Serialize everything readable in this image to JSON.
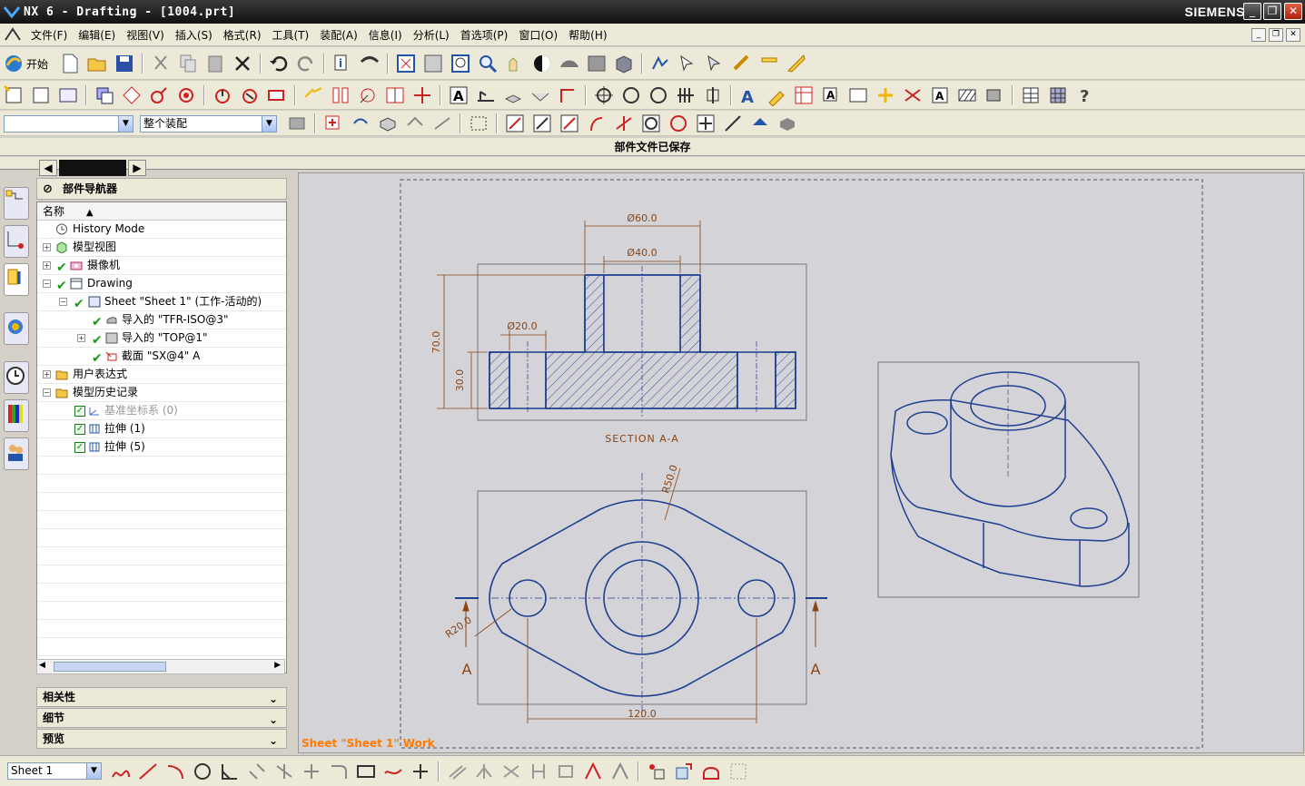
{
  "window": {
    "title": "NX 6 - Drafting - [1004.prt]",
    "brand": "SIEMENS"
  },
  "menu": [
    "文件(F)",
    "编辑(E)",
    "视图(V)",
    "插入(S)",
    "格式(R)",
    "工具(T)",
    "装配(A)",
    "信息(I)",
    "分析(L)",
    "首选项(P)",
    "窗口(O)",
    "帮助(H)"
  ],
  "toolbar": {
    "start_label": "开始"
  },
  "selection": {
    "filter_value": "",
    "assembly_value": "整个装配"
  },
  "status": {
    "message": "部件文件已保存"
  },
  "navigator": {
    "title": "部件导航器",
    "column": "名称",
    "rows": [
      {
        "label": "History Mode"
      },
      {
        "label": "模型视图"
      },
      {
        "label": "摄像机"
      },
      {
        "label": "Drawing"
      },
      {
        "label": "Sheet \"Sheet 1\" (工作-活动的)"
      },
      {
        "label": "导入的 \"TFR-ISO@3\""
      },
      {
        "label": "导入的 \"TOP@1\""
      },
      {
        "label": "截面 \"SX@4\" A"
      },
      {
        "label": "用户表达式"
      },
      {
        "label": "模型历史记录"
      },
      {
        "label": "基准坐标系 (0)"
      },
      {
        "label": "拉伸 (1)"
      },
      {
        "label": "拉伸 (5)"
      }
    ]
  },
  "panels": {
    "dependencies": "相关性",
    "details": "细节",
    "preview": "预览"
  },
  "drawing": {
    "dim_d60": "Ø60.0",
    "dim_d40": "Ø40.0",
    "dim_d20": "Ø20.0",
    "dim_70": "70.0",
    "dim_30": "30.0",
    "section_label": "SECTION A-A",
    "dim_r50": "R50.0",
    "dim_r20": "R20.0",
    "dim_120": "120.0",
    "cut_left": "A",
    "cut_right": "A",
    "sheet_status": "Sheet \"Sheet 1\" Work"
  },
  "bottom": {
    "sheet_value": "Sheet 1"
  },
  "colors": {
    "drawing_line": "#1f3f8f",
    "dimension": "#8b4513",
    "canvas": "#d3d3d8",
    "hatch": "#1f3f8f"
  }
}
